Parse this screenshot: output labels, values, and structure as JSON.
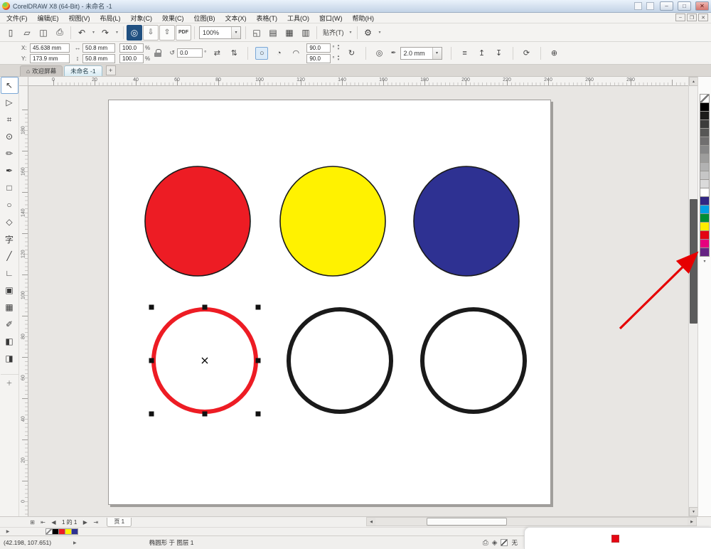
{
  "window": {
    "title": "CorelDRAW X8 (64-Bit) - 未命名 -1",
    "minimize": "–",
    "maximize": "□",
    "close": "✕",
    "doc_minimize": "–",
    "doc_restore": "❐",
    "doc_close": "✕"
  },
  "menus": [
    "文件(F)",
    "编辑(E)",
    "视图(V)",
    "布局(L)",
    "对象(C)",
    "效果(C)",
    "位图(B)",
    "文本(X)",
    "表格(T)",
    "工具(O)",
    "窗口(W)",
    "帮助(H)"
  ],
  "standard_toolbar": {
    "file_group": [
      {
        "name": "new-document-button",
        "glyph": "▯"
      },
      {
        "name": "open-button",
        "glyph": "▱"
      },
      {
        "name": "save-button",
        "glyph": "◫"
      },
      {
        "name": "print-button",
        "glyph": "⎙"
      }
    ],
    "undo_group": [
      {
        "name": "undo-button",
        "glyph": "↶"
      },
      {
        "name": "undo-dropdown",
        "glyph": "▾",
        "cls": "dd"
      },
      {
        "name": "redo-button",
        "glyph": "↷"
      },
      {
        "name": "redo-dropdown",
        "glyph": "▾",
        "cls": "dd"
      }
    ],
    "import_group": [
      {
        "name": "search-content-button",
        "glyph": "◎",
        "cls": "accent"
      },
      {
        "name": "import-button",
        "glyph": "⇩",
        "cls": "boxed"
      },
      {
        "name": "export-button",
        "glyph": "⇧",
        "cls": "boxed"
      },
      {
        "name": "publish-pdf-button",
        "glyph": "PDF",
        "cls": "pdf"
      }
    ],
    "zoom_value": "100%",
    "dropdown_glyph": "▾",
    "view_group": [
      {
        "name": "full-screen-button",
        "glyph": "◱"
      },
      {
        "name": "show-rulers-button",
        "glyph": "▤"
      },
      {
        "name": "show-grid-button",
        "glyph": "▦"
      },
      {
        "name": "show-guidelines-button",
        "glyph": "▥"
      }
    ],
    "snap_group": [
      {
        "name": "snap-to-button",
        "glyph": "贴齐(T)",
        "cls": "text"
      },
      {
        "name": "snap-to-dropdown",
        "glyph": "▾",
        "cls": "dd"
      }
    ],
    "tail_group": [
      {
        "name": "options-button",
        "glyph": "⚙"
      },
      {
        "name": "app-launcher-dropdown",
        "glyph": "▾",
        "cls": "dd"
      }
    ]
  },
  "property_bar": {
    "x_label": "X:",
    "x_value": "45.638 mm",
    "y_label": "Y:",
    "y_value": "173.9 mm",
    "width_icon": "↔",
    "width_value": "50.8 mm",
    "height_icon": "↕",
    "height_value": "50.8 mm",
    "scale_h_value": "100.0",
    "scale_v_value": "100.0",
    "percent": "%",
    "rotation_icon": "↺",
    "rotation_value": "0.0",
    "degree": "°",
    "mirror_h_icon": "⇄",
    "mirror_v_icon": "⇅",
    "ellipse_icon": "○",
    "pie_icon": "◔",
    "arc_icon": "◠",
    "arc_angle_1": "90.0",
    "arc_angle_2": "90.0",
    "spin_up": "▴",
    "spin_down": "▾",
    "direction_icon": "↻",
    "outline_position_icon": "◎",
    "outline_pen_icon": "✒",
    "outline_width_value": "2.0 mm",
    "wrap_icon": "≡",
    "to_front_icon": "↥",
    "to_back_icon": "↧",
    "refresh_icon": "⟳",
    "add_icon": "⊕"
  },
  "document_tabs": {
    "welcome_icon": "⌂",
    "welcome_label": "欢迎屏幕",
    "active_label": "未命名 -1",
    "new_tab": "+"
  },
  "rulers": {
    "horizontal": [
      "0",
      "20",
      "40",
      "60",
      "80",
      "100",
      "120",
      "140",
      "160",
      "180",
      "200",
      "220",
      "240",
      "260",
      "280"
    ],
    "vertical": [
      "180",
      "160",
      "140",
      "120",
      "100",
      "80",
      "60",
      "40",
      "20",
      "0"
    ]
  },
  "toolbox": [
    {
      "name": "pick-tool",
      "glyph": "↖",
      "cls": "active"
    },
    {
      "name": "shape-tool",
      "glyph": "▷"
    },
    {
      "name": "crop-tool",
      "glyph": "⌗"
    },
    {
      "name": "zoom-tool",
      "glyph": "⊙"
    },
    {
      "name": "freehand-tool",
      "glyph": "✏"
    },
    {
      "name": "artistic-media-tool",
      "glyph": "✒"
    },
    {
      "name": "rectangle-tool",
      "glyph": "□"
    },
    {
      "name": "ellipse-tool",
      "glyph": "○"
    },
    {
      "name": "polygon-tool",
      "glyph": "◇"
    },
    {
      "name": "text-tool",
      "glyph": "字"
    },
    {
      "name": "dimension-tool",
      "glyph": "╱"
    },
    {
      "name": "connector-tool",
      "glyph": "∟"
    },
    {
      "name": "drop-shadow-tool",
      "glyph": "▣"
    },
    {
      "name": "transparency-tool",
      "glyph": "▦"
    },
    {
      "name": "eyedropper-tool",
      "glyph": "✐"
    },
    {
      "name": "interactive-fill-tool",
      "glyph": "◧"
    },
    {
      "name": "smart-fill-tool",
      "glyph": "◨"
    },
    {
      "name": "add-tools-button",
      "glyph": "＋",
      "cls": "plus"
    }
  ],
  "canvas": {
    "red_circle_fill": "#ed1c24",
    "yellow_circle_fill": "#fff200",
    "blue_circle_fill": "#2e3192",
    "filled_outline_color": "#1a1a1a",
    "selected_circle_stroke": "#ed1c24",
    "outline_circle_color": "#1a1a1a",
    "handle_color": "#111111",
    "arrow_color": "#e60000"
  },
  "color_palette": {
    "swatches": [
      {
        "name": "no-color-swatch",
        "cls": "none"
      },
      {
        "name": "swatch-black",
        "color": "#000000"
      },
      {
        "name": "swatch-90-black",
        "color": "#1d1d1b"
      },
      {
        "name": "swatch-80-black",
        "color": "#3c3c3b"
      },
      {
        "name": "swatch-70-black",
        "color": "#575756"
      },
      {
        "name": "swatch-60-black",
        "color": "#706f6f"
      },
      {
        "name": "swatch-50-black",
        "color": "#878787"
      },
      {
        "name": "swatch-40-black",
        "color": "#9d9d9c"
      },
      {
        "name": "swatch-30-black",
        "color": "#b2b2b2"
      },
      {
        "name": "swatch-20-black",
        "color": "#c6c6c6"
      },
      {
        "name": "swatch-10-black",
        "color": "#dadada"
      },
      {
        "name": "swatch-white",
        "color": "#ffffff"
      },
      {
        "name": "swatch-blue",
        "color": "#312783"
      },
      {
        "name": "swatch-cyan",
        "color": "#009fe3"
      },
      {
        "name": "swatch-green",
        "color": "#008d36"
      },
      {
        "name": "swatch-yellow",
        "color": "#ffed00"
      },
      {
        "name": "swatch-red",
        "color": "#e30613"
      },
      {
        "name": "swatch-magenta",
        "color": "#e6007e"
      },
      {
        "name": "swatch-purple",
        "color": "#662483"
      }
    ],
    "scroll_down": "▾"
  },
  "scrollbars": {
    "up": "▲",
    "down": "▼",
    "left": "◀",
    "right": "▶"
  },
  "page_controls": {
    "sorter_glyph": "⊞",
    "first_glyph": "⇤",
    "prev_glyph": "◀",
    "label": "1 的 1",
    "next_glyph": "▶",
    "last_glyph": "⇥",
    "page_tab_label": "页 1"
  },
  "document_palette": {
    "expand_glyph": "▶",
    "swatches": [
      {
        "name": "doc-swatch-none",
        "cls": "none"
      },
      {
        "name": "doc-swatch-black",
        "color": "#000000"
      },
      {
        "name": "doc-swatch-red",
        "color": "#ed1c24"
      },
      {
        "name": "doc-swatch-yellow",
        "color": "#fff200"
      },
      {
        "name": "doc-swatch-blue",
        "color": "#2e3192"
      }
    ]
  },
  "status_bar": {
    "coords": "(42.198, 107.651)",
    "expand_glyph": "▶",
    "object_info": "椭圆形 于 图层 1",
    "printer_icon": "⎙",
    "fill_icon": "◈",
    "fill_none_label": "无"
  },
  "overlay": {
    "swatch_color": "#e60613"
  }
}
